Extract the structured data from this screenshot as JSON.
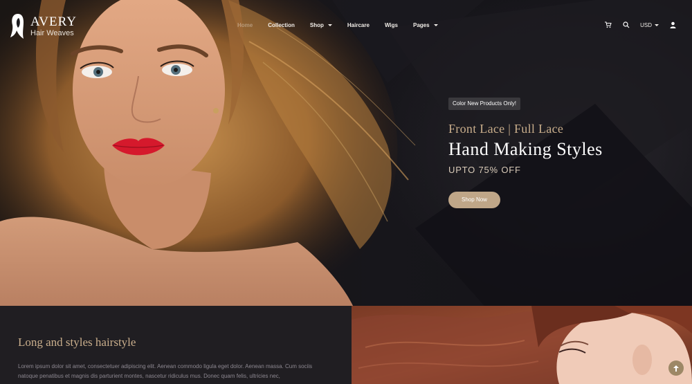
{
  "brand": {
    "name": "AVERY",
    "tagline": "Hair Weaves"
  },
  "nav": {
    "items": [
      {
        "label": "Home",
        "has_dropdown": false
      },
      {
        "label": "Collection",
        "has_dropdown": false
      },
      {
        "label": "Shop",
        "has_dropdown": true
      },
      {
        "label": "Haircare",
        "has_dropdown": false
      },
      {
        "label": "Wigs",
        "has_dropdown": false
      },
      {
        "label": "Pages",
        "has_dropdown": true
      }
    ]
  },
  "tools": {
    "cart_icon": "cart-icon",
    "search_icon": "search-icon",
    "currency": "USD",
    "account_icon": "user-icon"
  },
  "hero": {
    "badge": "Color New Products Only!",
    "subtitle": "Front Lace | Full Lace",
    "title": "Hand Making Styles",
    "offer": "UPTO 75% OFF",
    "cta": "Shop Now"
  },
  "section": {
    "title": "Long and styles hairstyle",
    "text": "Lorem ipsum dolor sit amet, consectetuer adipiscing elit. Aenean commodo ligula eget dolor. Aenean massa. Cum sociis natoque penatibus et magnis dis parturient montes, nascetur ridiculus mus. Donec quam felis, ultricies nec,"
  },
  "colors": {
    "accent": "#bfa688",
    "gold_text": "#c9ae8c",
    "dark_bg": "#16151a",
    "panel_bg": "#201e22"
  }
}
